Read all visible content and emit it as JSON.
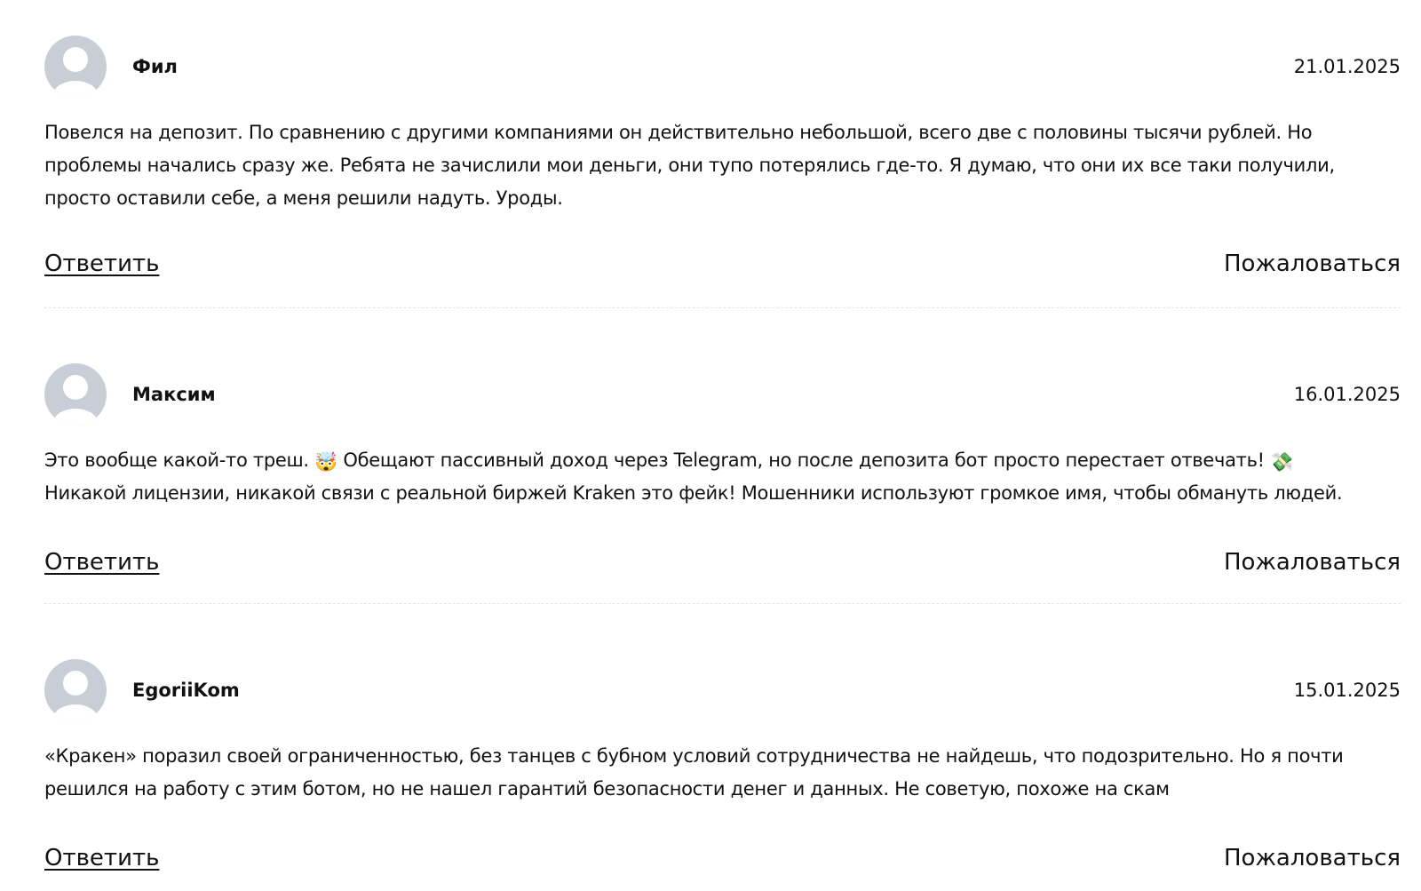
{
  "comments": [
    {
      "author": "Фил",
      "date": "21.01.2025",
      "lines": [
        "Повелся на депозит. По сравнению с другими компаниями он действительно небольшой, всего две с половины тысячи рублей. Но",
        "проблемы начались сразу же. Ребята не зачислили мои деньги, они тупо потерялись где-то. Я думаю, что они их все таки получили,",
        "просто оставили себе, а меня решили надуть. Уроды."
      ],
      "reply_label": "Ответить",
      "complain_label": "Пожаловаться"
    },
    {
      "author": "Максим",
      "date": "16.01.2025",
      "line1_a": "Это вообще какой-то треш.",
      "emoji1": "🤯",
      "line1_b": "Обещают пассивный доход через Telegram, но после депозита бот просто перестает отвечать!",
      "emoji2": "💸",
      "line2": "Никакой лицензии, никакой связи с реальной биржей Kraken это фейк! Мошенники используют громкое имя, чтобы обмануть людей.",
      "reply_label": "Ответить",
      "complain_label": "Пожаловаться"
    },
    {
      "author": "EgoriiKom",
      "date": "15.01.2025",
      "lines": [
        "«Кракен» поразил своей ограниченностью, без танцев с бубном условий сотрудничества не найдешь, что подозрительно. Но я почти",
        "решился на работу с этим ботом, но не нашел гарантий безопасности денег и данных. Не советую, похоже на скам"
      ],
      "reply_label": "Ответить",
      "complain_label": "Пожаловаться"
    }
  ],
  "icons": {
    "avatar": "user-placeholder-icon"
  },
  "colors": {
    "text": "#111111",
    "avatar": "#c9ced6",
    "divider": "#e3e3e3"
  }
}
